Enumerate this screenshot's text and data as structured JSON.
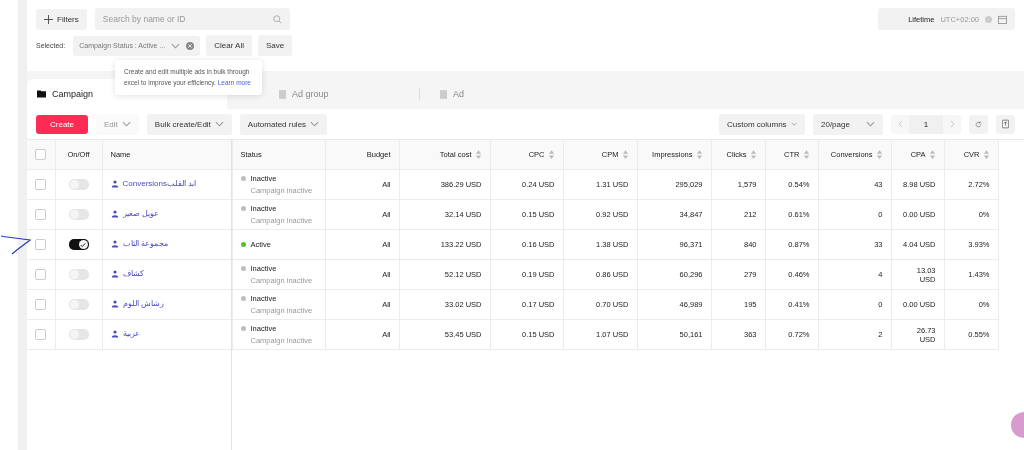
{
  "filters": {
    "add_button": "Filters",
    "search": {
      "placeholder": "Search by name or ID"
    },
    "date": {
      "label": "Lifetime",
      "timezone": "UTC+02:00"
    },
    "selected_label": "Selected:",
    "chips": [
      {
        "label": "Campaign Status : Active ..."
      }
    ],
    "clear_all": "Clear All",
    "save": "Save"
  },
  "tooltip": {
    "text": "Create and edit multiple ads in bulk through excel to improve your efficiency.",
    "link": "Learn more"
  },
  "tabs": [
    {
      "label": "Campaign",
      "selected": true
    },
    {
      "label": "Ad group",
      "selected": false
    },
    {
      "label": "Ad",
      "selected": false
    }
  ],
  "toolbar": {
    "create": "Create",
    "edit": {
      "label": "Edit",
      "disabled": true
    },
    "bulk": "Bulk create/Edit",
    "rules": "Automated rules",
    "custom_columns": "Custom columns",
    "page_size": "20/page",
    "page": "1"
  },
  "table": {
    "header_checked": false,
    "columns": [
      {
        "label": "On/Off",
        "sortable": false
      },
      {
        "label": "Name",
        "sortable": false
      },
      {
        "label": "Status",
        "sortable": false
      }
    ],
    "metric_columns": [
      {
        "label": "Budget",
        "sortable": false
      },
      {
        "label": "Total cost",
        "sortable": true
      },
      {
        "label": "CPC",
        "sortable": true
      },
      {
        "label": "CPM",
        "sortable": true
      },
      {
        "label": "Impressions",
        "sortable": true
      },
      {
        "label": "Clicks",
        "sortable": true
      },
      {
        "label": "CTR",
        "sortable": true
      },
      {
        "label": "Conversions",
        "sortable": true
      },
      {
        "label": "CPA",
        "sortable": true
      },
      {
        "label": "CVR",
        "sortable": true
      }
    ],
    "rows": [
      {
        "selected": false,
        "on": false,
        "name": "Conversionsابد القلب",
        "status": {
          "label": "Inactive",
          "detail": "Campaign inactive",
          "color": "#bdbdbd"
        },
        "cells": [
          "All",
          "386.29 USD",
          "0.24 USD",
          "1.31 USD",
          "295,029",
          "1,579",
          "0.54%",
          "43",
          "8.98 USD",
          "2.72%"
        ]
      },
      {
        "selected": false,
        "on": false,
        "name": "عويل صغير",
        "status": {
          "label": "Inactive",
          "detail": "Campaign inactive",
          "color": "#bdbdbd"
        },
        "cells": [
          "All",
          "32.14 USD",
          "0.15 USD",
          "0.92 USD",
          "34,847",
          "212",
          "0.61%",
          "0",
          "0.00 USD",
          "0%"
        ]
      },
      {
        "selected": false,
        "on": true,
        "name": "مجموعة الثاب",
        "status": {
          "label": "Active",
          "color": "#52c41a"
        },
        "cells": [
          "All",
          "133.22 USD",
          "0.16 USD",
          "1.38 USD",
          "96,371",
          "840",
          "0.87%",
          "33",
          "4.04 USD",
          "3.93%"
        ]
      },
      {
        "selected": false,
        "on": false,
        "name": "كشاف",
        "status": {
          "label": "Inactive",
          "detail": "Campaign inactive",
          "color": "#bdbdbd"
        },
        "cells": [
          "All",
          "52.12 USD",
          "0.19 USD",
          "0.86 USD",
          "60,296",
          "279",
          "0.46%",
          "4",
          "13.03 USD",
          "1.43%"
        ]
      },
      {
        "selected": false,
        "on": false,
        "name": "رشاش اللوم",
        "status": {
          "label": "Inactive",
          "detail": "Campaign inactive",
          "color": "#bdbdbd"
        },
        "cells": [
          "All",
          "33.02 USD",
          "0.17 USD",
          "0.70 USD",
          "46,989",
          "195",
          "0.41%",
          "0",
          "0.00 USD",
          "0%"
        ]
      },
      {
        "selected": false,
        "on": false,
        "name": "عربية",
        "status": {
          "label": "Inactive",
          "detail": "Campaign inactive",
          "color": "#bdbdbd"
        },
        "cells": [
          "All",
          "53.45 USD",
          "0.15 USD",
          "1.07 USD",
          "50,161",
          "363",
          "0.72%",
          "2",
          "26.73 USD",
          "0.55%"
        ]
      }
    ]
  }
}
